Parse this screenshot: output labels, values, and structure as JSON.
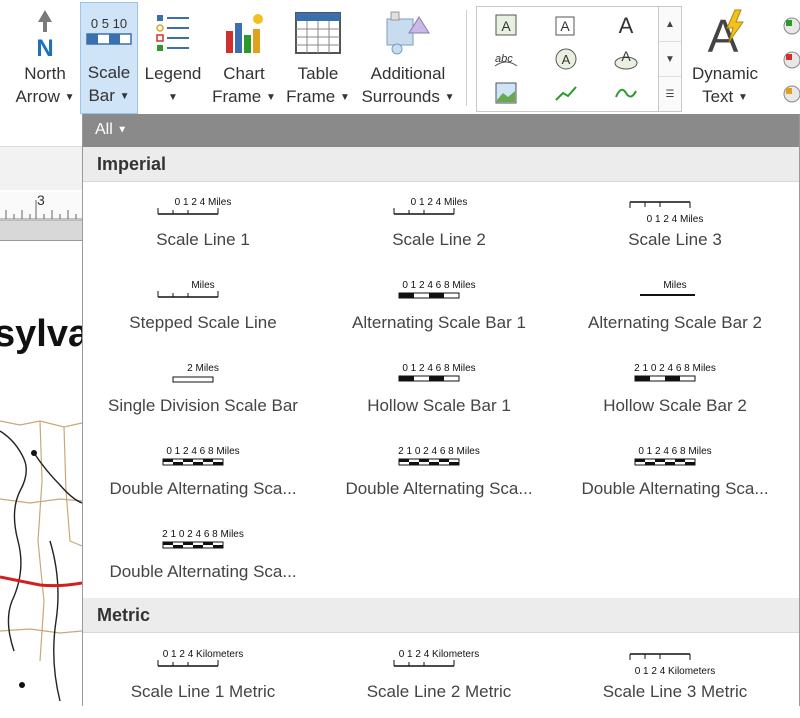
{
  "ribbon": {
    "north_arrow": {
      "line1": "North",
      "line2": "Arrow"
    },
    "scale_bar": {
      "line1": "Scale",
      "line2": "Bar"
    },
    "legend": {
      "line1": "Legend"
    },
    "chart_frame": {
      "line1": "Chart",
      "line2": "Frame"
    },
    "table_frame": {
      "line1": "Table",
      "line2": "Frame"
    },
    "additional_surrounds": {
      "line1": "Additional",
      "line2": "Surrounds"
    },
    "dynamic_text": {
      "line1": "Dynamic",
      "line2": "Text"
    },
    "scale_icon_numbers": "0 5 10"
  },
  "map": {
    "ruler_number": "3",
    "title_fragment": "sylva"
  },
  "panel": {
    "filter": "All",
    "sections": [
      {
        "title": "Imperial",
        "items": [
          {
            "name": "Scale Line 1",
            "thumb": "0  1  2        4 Miles"
          },
          {
            "name": "Scale Line 2",
            "thumb": "0  1  2        4 Miles"
          },
          {
            "name": "Scale Line 3",
            "thumb": "0  1  2        4 Miles"
          },
          {
            "name": "Stepped Scale Line",
            "thumb": "Miles"
          },
          {
            "name": "Alternating Scale Bar 1",
            "thumb": "0 1 2 4 6 8 Miles"
          },
          {
            "name": "Alternating Scale Bar 2",
            "thumb": "Miles"
          },
          {
            "name": "Single Division Scale Bar",
            "thumb": "2 Miles"
          },
          {
            "name": "Hollow Scale Bar 1",
            "thumb": "0 1 2 4 6 8 Miles"
          },
          {
            "name": "Hollow Scale Bar 2",
            "thumb": "2 1 0 2 4 6 8 Miles"
          },
          {
            "name": "Double Alternating Sca...",
            "thumb": "0 1 2 4 6 8 Miles"
          },
          {
            "name": "Double Alternating Sca...",
            "thumb": "2 1 0 2 4 6 8 Miles"
          },
          {
            "name": "Double Alternating Sca...",
            "thumb": "0 1 2 4 6 8 Miles"
          },
          {
            "name": "Double Alternating Sca...",
            "thumb": "2 1 0 2 4 6 8 Miles"
          }
        ]
      },
      {
        "title": "Metric",
        "items": [
          {
            "name": "Scale Line 1 Metric",
            "thumb": "0  1  2        4 Kilometers"
          },
          {
            "name": "Scale Line 2 Metric",
            "thumb": "0  1  2        4 Kilometers"
          },
          {
            "name": "Scale Line 3 Metric",
            "thumb": "0  1  2        4 Kilometers"
          }
        ]
      }
    ]
  },
  "colors": {
    "accent_selected": "#cfe4f7",
    "filter_bar": "#8a8a8a",
    "section_bg": "#ececec"
  }
}
